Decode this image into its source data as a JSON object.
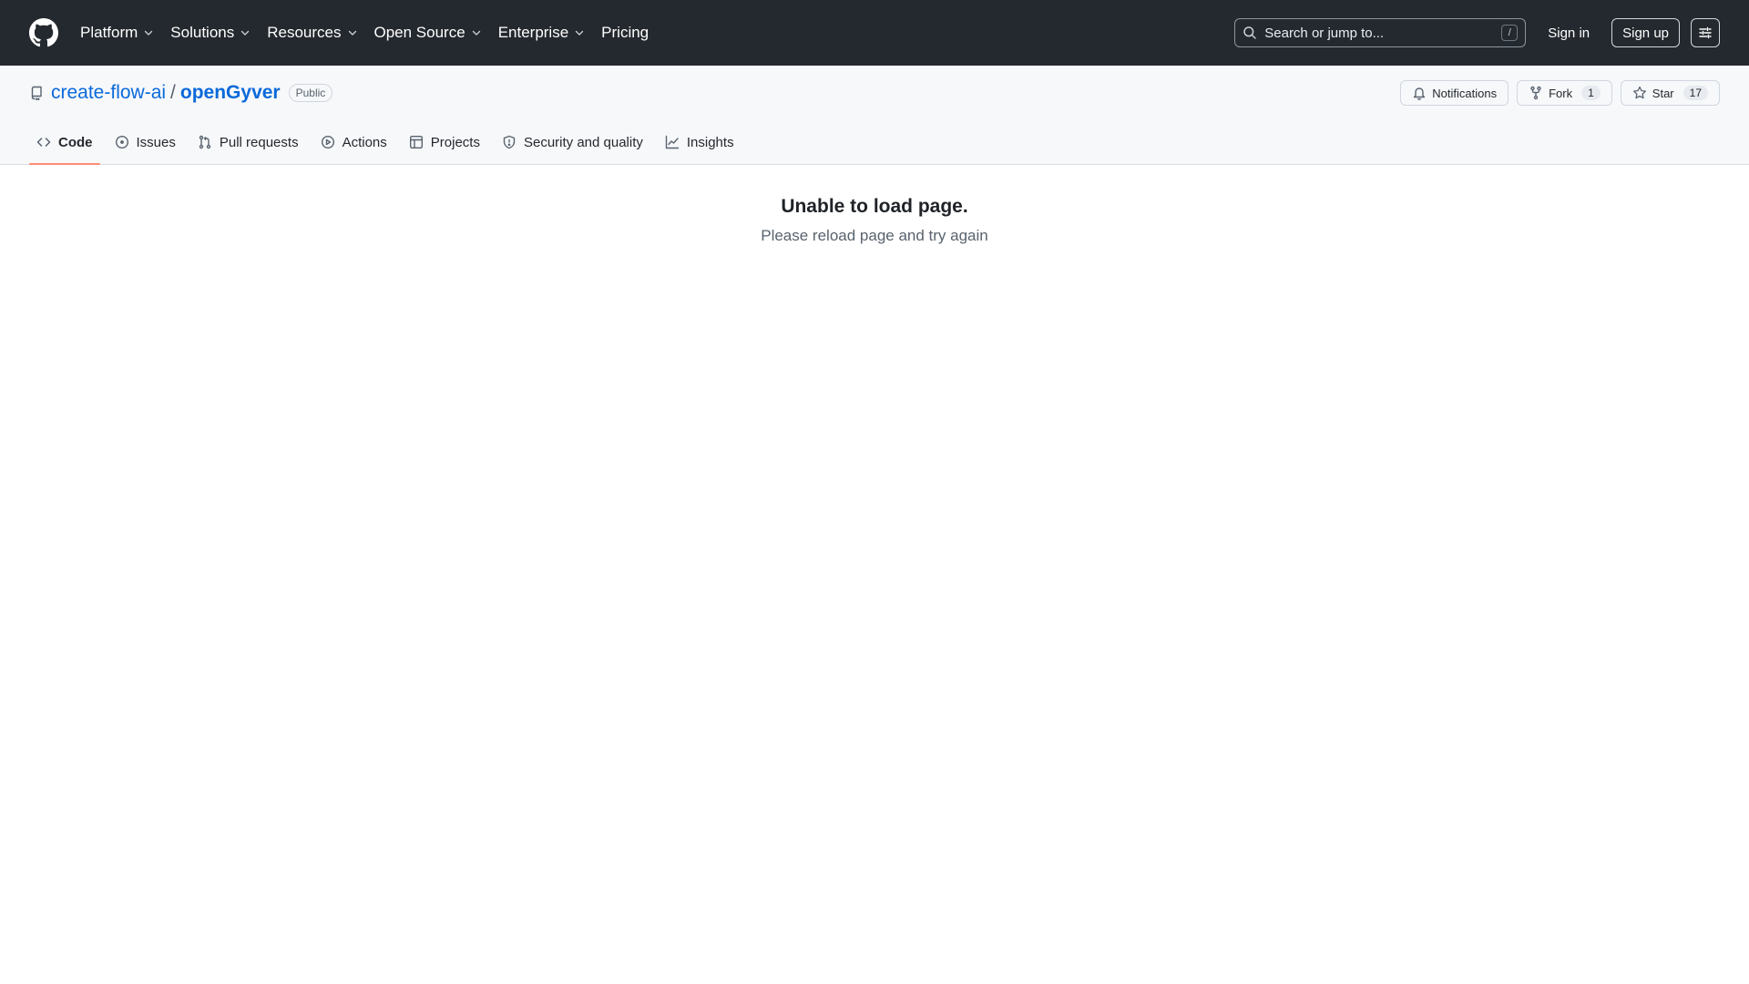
{
  "header": {
    "nav": [
      {
        "label": "Platform",
        "has_dropdown": true
      },
      {
        "label": "Solutions",
        "has_dropdown": true
      },
      {
        "label": "Resources",
        "has_dropdown": true
      },
      {
        "label": "Open Source",
        "has_dropdown": true
      },
      {
        "label": "Enterprise",
        "has_dropdown": true
      },
      {
        "label": "Pricing",
        "has_dropdown": false
      }
    ],
    "search_placeholder": "Search or jump to...",
    "search_shortcut": "/",
    "sign_in": "Sign in",
    "sign_up": "Sign up"
  },
  "repo": {
    "owner": "create-flow-ai",
    "separator": "/",
    "name": "openGyver",
    "visibility": "Public",
    "notifications_label": "Notifications",
    "fork_label": "Fork",
    "fork_count": "1",
    "star_label": "Star",
    "star_count": "17"
  },
  "tabs": [
    {
      "label": "Code",
      "icon": "code-icon",
      "selected": true
    },
    {
      "label": "Issues",
      "icon": "issue-icon",
      "selected": false
    },
    {
      "label": "Pull requests",
      "icon": "pull-request-icon",
      "selected": false
    },
    {
      "label": "Actions",
      "icon": "play-icon",
      "selected": false
    },
    {
      "label": "Projects",
      "icon": "table-icon",
      "selected": false
    },
    {
      "label": "Security and quality",
      "icon": "shield-icon",
      "selected": false
    },
    {
      "label": "Insights",
      "icon": "graph-icon",
      "selected": false
    }
  ],
  "main": {
    "error_title": "Unable to load page.",
    "error_message": "Please reload page and try again"
  },
  "colors": {
    "header_bg": "#24292f",
    "link": "#0969da",
    "tab_underline": "#fd8c73"
  }
}
